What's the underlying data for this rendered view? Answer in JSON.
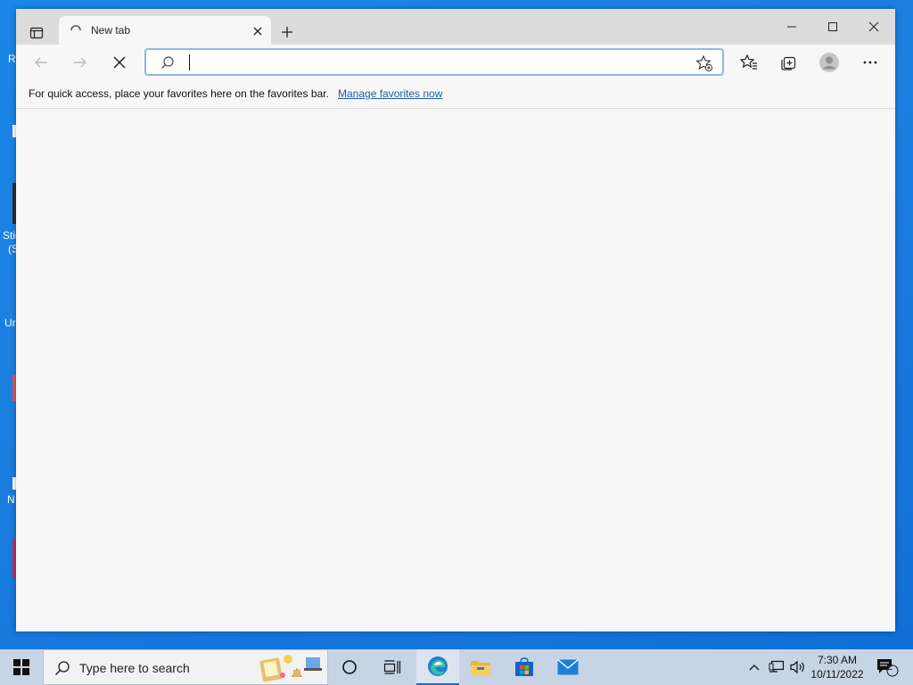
{
  "desktop": {
    "fragments": [
      "R",
      "Stic",
      "(S",
      "Ur",
      "N"
    ]
  },
  "browser": {
    "tab": {
      "title": "New tab",
      "loading": true
    },
    "window_controls": [
      "minimize",
      "maximize",
      "close"
    ],
    "address": {
      "value": "",
      "placeholder": ""
    },
    "favorites_bar": {
      "message": "For quick access, place your favorites here on the favorites bar.",
      "link": "Manage favorites now"
    }
  },
  "taskbar": {
    "search_placeholder": "Type here to search",
    "apps": [
      "cortana",
      "task-view",
      "edge",
      "file-explorer",
      "store",
      "mail"
    ],
    "active_app": "edge",
    "clock": {
      "time": "7:30 AM",
      "date": "10/11/2022"
    },
    "notifications": "2"
  },
  "colors": {
    "desktop": "#1a86e8",
    "titlebar": "#dcdcdc",
    "accent": "#1a6fd0",
    "link": "#1d5fa6"
  }
}
